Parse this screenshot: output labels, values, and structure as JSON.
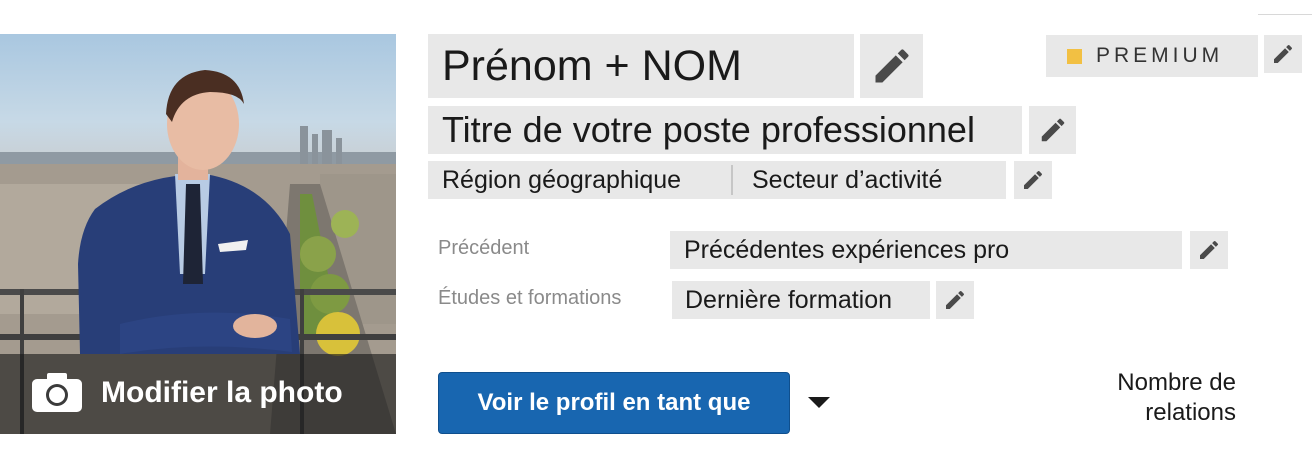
{
  "photo": {
    "edit_label": "Modifier la photo",
    "camera_icon": "camera-icon"
  },
  "profile": {
    "name": "Prénom + NOM",
    "job_title": "Titre de votre poste professionnel",
    "region": "Région géographique",
    "sector": "Secteur d’activité"
  },
  "details": {
    "previous_label": "Précédent",
    "previous_value": "Précédentes expériences pro",
    "education_label": "Études et formations",
    "education_value": "Dernière formation"
  },
  "premium": {
    "label": "PREMIUM",
    "accent": "#f2c043"
  },
  "actions": {
    "view_profile_as": "Voir le profil en tant que"
  },
  "relations": {
    "line1": "Nombre de",
    "line2": "relations"
  },
  "colors": {
    "field_bg": "#e8e8e8",
    "button_blue": "#1866b0",
    "icon_gray": "#4a4a4a"
  }
}
